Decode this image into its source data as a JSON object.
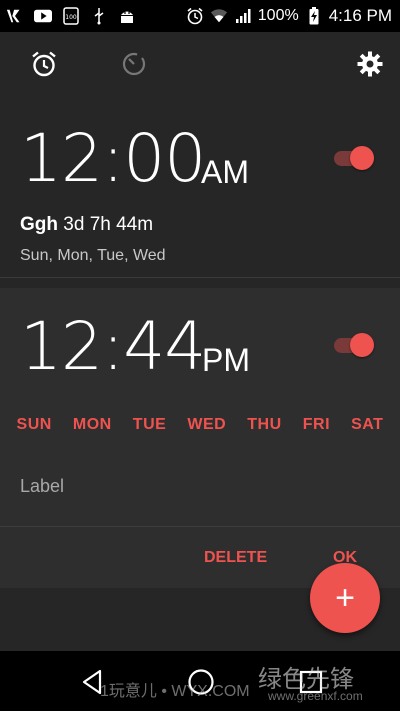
{
  "status_bar": {
    "battery_percent": "100%",
    "time": "4:16 PM"
  },
  "toolbar": {
    "alarm_tab_icon": "alarm-clock-icon",
    "timer_tab_icon": "timer-icon",
    "settings_icon": "gear-icon"
  },
  "alarms": [
    {
      "time": "12:00",
      "ampm": "AM",
      "enabled": true,
      "label": "Ggh",
      "countdown": "3d 7h 44m",
      "repeat_days": "Sun, Mon, Tue, Wed"
    },
    {
      "time": "12:44",
      "ampm": "PM",
      "enabled": true,
      "weekdays": [
        "SUN",
        "MON",
        "TUE",
        "WED",
        "THU",
        "FRI",
        "SAT"
      ],
      "label_placeholder": "Label",
      "delete_label": "DELETE",
      "ok_label": "OK"
    }
  ],
  "fab": {
    "label": "+"
  },
  "watermark": {
    "left": "1玩意儿 • WYX.COM",
    "right": "绿色先锋",
    "right_sub": "www.greenxf.com"
  },
  "colors": {
    "accent": "#ef5350",
    "background": "#262626",
    "expanded_card": "#2e2e2e"
  }
}
